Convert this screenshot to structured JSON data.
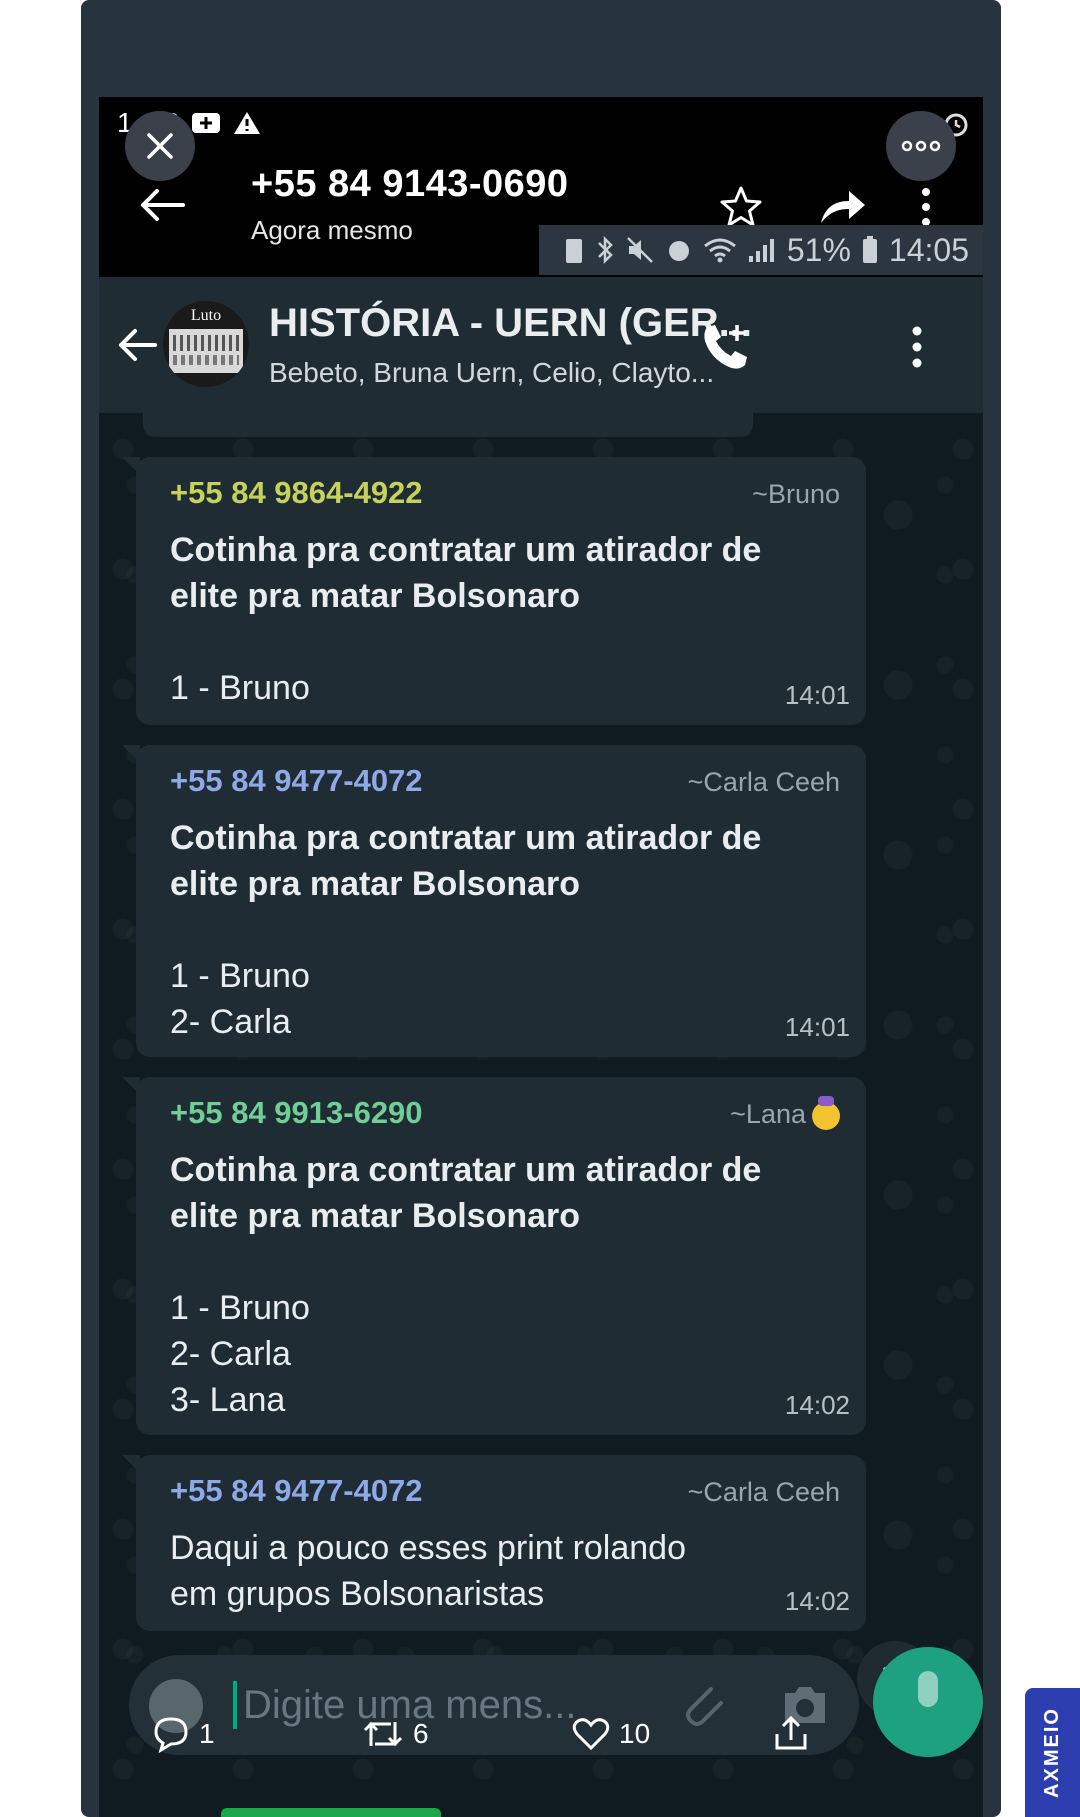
{
  "viewer": {
    "status_time": "1",
    "phone_number": "+55 84 9143-0690",
    "subtitle": "Agora mesmo",
    "status_line": "51%",
    "status_clock": "14:05"
  },
  "chat_header": {
    "avatar_text": "Luto",
    "title": "HISTÓRIA - UERN (GER...",
    "members": "Bebeto, Bruna Uern, Celio, Clayto..."
  },
  "messages": [
    {
      "sender": "+55 84 9864-4922",
      "sender_color": "#c6d35a",
      "alias": "~Bruno",
      "bold_text": [
        "Cotinha pra contratar um atirador de",
        "elite pra matar Bolsonaro"
      ],
      "lines": [
        "1 - Bruno"
      ],
      "time": "14:01"
    },
    {
      "sender": "+55 84 9477-4072",
      "sender_color": "#8fa8e8",
      "alias": "~Carla Ceeh",
      "bold_text": [
        "Cotinha pra contratar um atirador de",
        "elite pra matar Bolsonaro"
      ],
      "lines": [
        "1 - Bruno",
        "2- Carla"
      ],
      "time": "14:01"
    },
    {
      "sender": "+55 84 9913-6290",
      "sender_color": "#6fcf97",
      "alias": "~Lana",
      "bold_text": [
        "Cotinha pra contratar um atirador de",
        "elite pra matar Bolsonaro"
      ],
      "lines": [
        "1 - Bruno",
        "2- Carla",
        "3- Lana"
      ],
      "time": "14:02"
    },
    {
      "sender": "+55 84 9477-4072",
      "sender_color": "#8fa8e8",
      "alias": "~Carla Ceeh",
      "lines": [
        "Daqui a pouco esses print rolando",
        "em grupos Bolsonaristas"
      ],
      "time": "14:02"
    }
  ],
  "input": {
    "placeholder": "Digite uma mens..."
  },
  "actions": {
    "replies": "1",
    "retweets": "6",
    "likes": "10"
  },
  "side_tab": "AXMEIO"
}
